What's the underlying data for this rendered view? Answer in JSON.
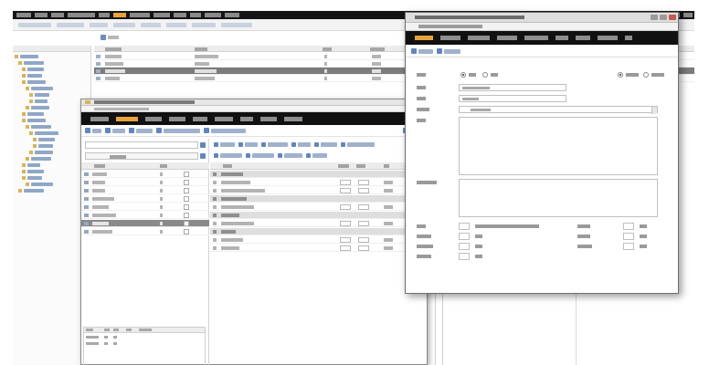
{
  "app": {
    "menu_count": 14,
    "toolbar_count": 8,
    "tree_items": 22,
    "grid_rows": 4,
    "grid_selected_row": 2
  },
  "dialog_recipe": {
    "nav_count": 9,
    "active_nav": 1,
    "toolbar_count": 7,
    "ingredient_rows": 8,
    "selected_ingredient": 6,
    "step_rows": 10
  },
  "dialog_edit": {
    "nav_count": 9,
    "active_nav": 0,
    "form_rows": 4,
    "extra_rows": 4
  },
  "colors": {
    "topbar": "#151515",
    "accent_nav": "#e8a33c",
    "link_icon": "#5f86c1",
    "selection": "#8a8a8a",
    "close_button": "#c9584f"
  },
  "icons": [
    "add-icon",
    "search-icon",
    "folder-icon",
    "close-icon",
    "maximize-icon",
    "minimize-icon"
  ]
}
